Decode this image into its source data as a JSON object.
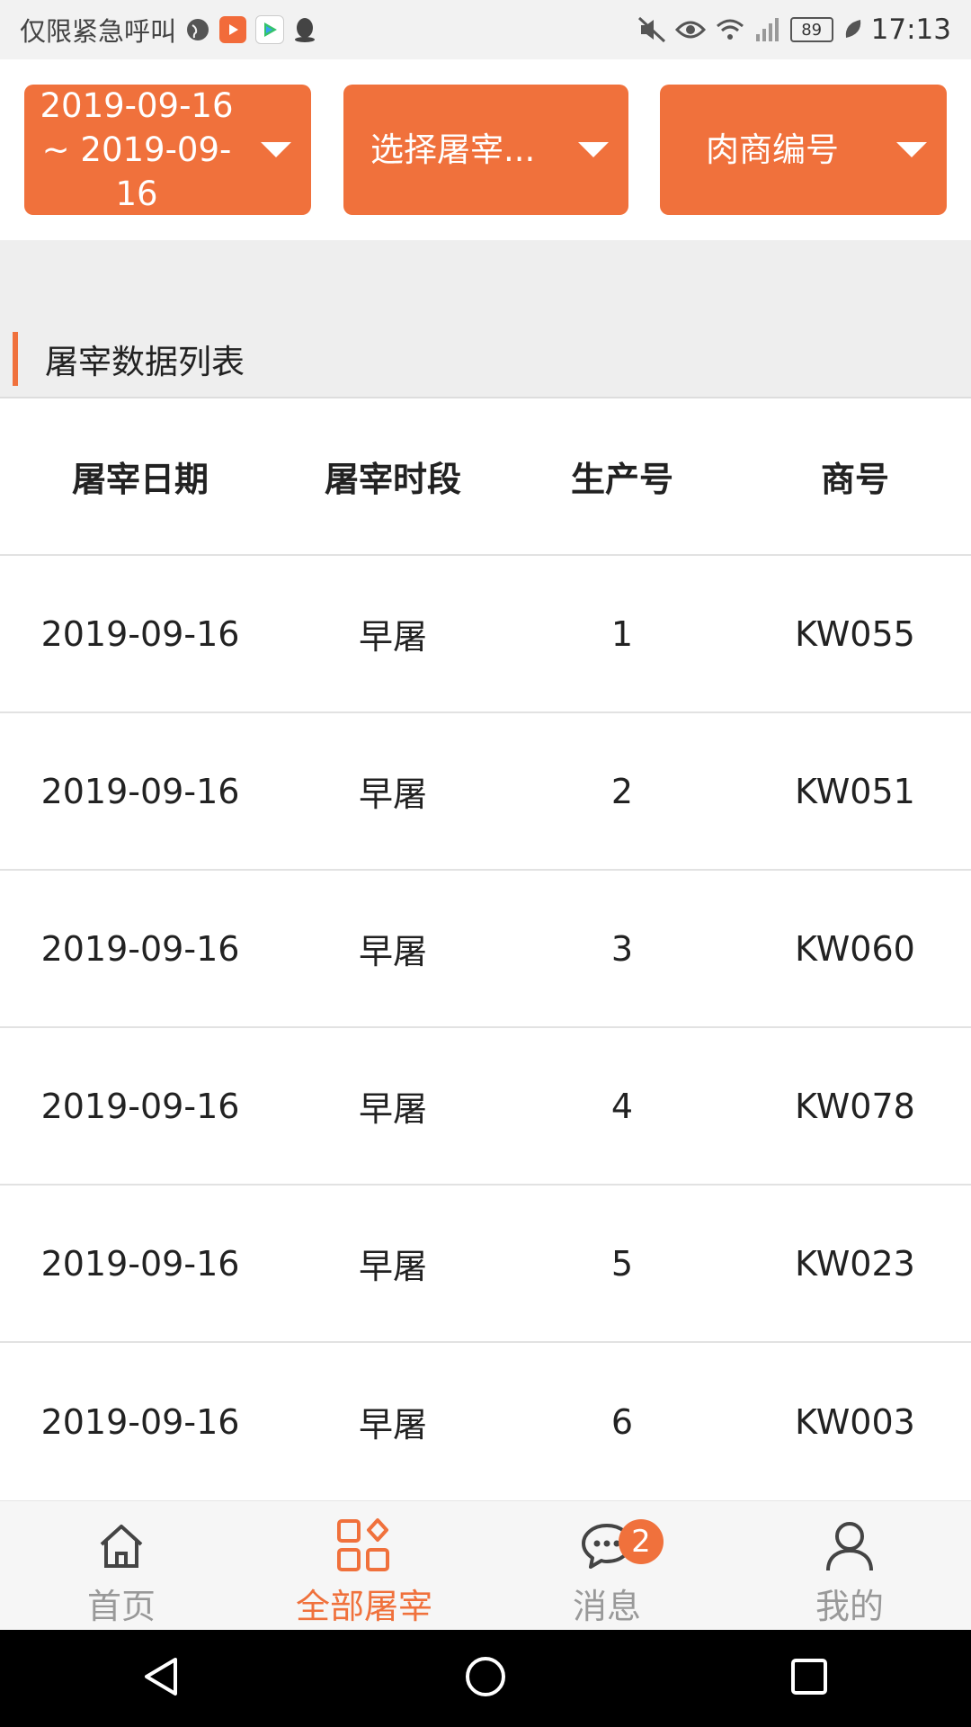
{
  "status_bar": {
    "carrier_text": "仅限紧急呼叫",
    "battery": "89",
    "time": "17:13"
  },
  "filters": {
    "date_range": "2019-09-16 ~ 2019-09-16",
    "date_range_line1": "2019-09-16",
    "date_range_line2": "~ 2019-09-",
    "date_range_line3": "16",
    "slaughterhouse": "选择屠宰...",
    "merchant_code": "肉商编号"
  },
  "section": {
    "title": "屠宰数据列表"
  },
  "table": {
    "columns": [
      "屠宰日期",
      "屠宰时段",
      "生产号",
      "商号"
    ],
    "rows": [
      {
        "date": "2019-09-16",
        "period": "早屠",
        "prod_no": "1",
        "code": "KW055"
      },
      {
        "date": "2019-09-16",
        "period": "早屠",
        "prod_no": "2",
        "code": "KW051"
      },
      {
        "date": "2019-09-16",
        "period": "早屠",
        "prod_no": "3",
        "code": "KW060"
      },
      {
        "date": "2019-09-16",
        "period": "早屠",
        "prod_no": "4",
        "code": "KW078"
      },
      {
        "date": "2019-09-16",
        "period": "早屠",
        "prod_no": "5",
        "code": "KW023"
      },
      {
        "date": "2019-09-16",
        "period": "早屠",
        "prod_no": "6",
        "code": "KW003"
      }
    ]
  },
  "tabbar": {
    "items": [
      {
        "label": "首页",
        "icon": "home-icon"
      },
      {
        "label": "全部屠宰",
        "icon": "grid-icon",
        "active": true
      },
      {
        "label": "消息",
        "icon": "chat-icon",
        "badge": "2"
      },
      {
        "label": "我的",
        "icon": "user-icon"
      }
    ]
  },
  "colors": {
    "accent": "#f0713c"
  }
}
